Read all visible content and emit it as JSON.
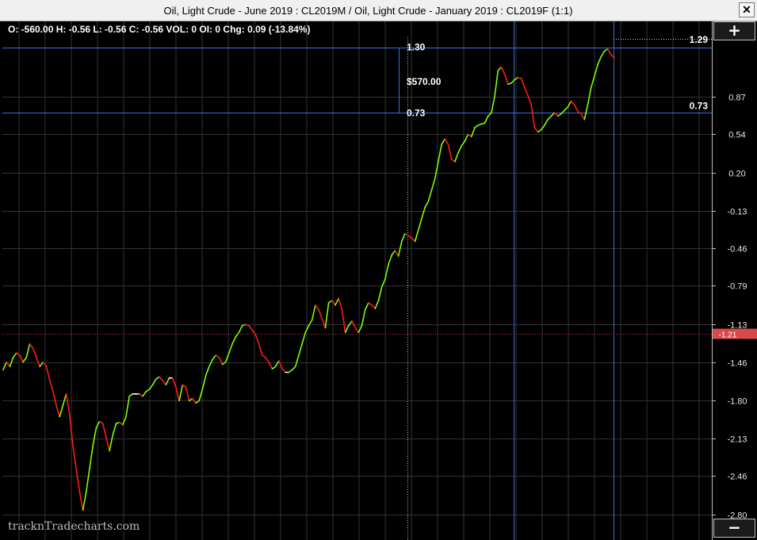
{
  "window": {
    "title": "Oil, Light Crude - June 2019 : CL2019M / Oil, Light Crude - January 2019 : CL2019F  (1:1)",
    "close_label": "✕"
  },
  "stats": {
    "text": "O: -560.00  H: -0.56  L: -0.56  C: -0.56 VOL: 0 OI: 0 Chg: 0.09 (-13.84%)"
  },
  "controls": {
    "zoom_in_label": "+",
    "zoom_out_label": "−"
  },
  "watermark": "tracknTradecharts.com",
  "colors": {
    "background": "#000000",
    "up": "#7fff00",
    "down": "#ff1a1a",
    "flat": "#ffffff",
    "grid": "#333333",
    "measure": "#3b6fe0",
    "last_badge": "#d84a4a"
  },
  "chart_data": {
    "type": "line",
    "ylim": [
      -2.9,
      1.35
    ],
    "yticks": [
      -2.8,
      -2.46,
      -2.13,
      -1.8,
      -1.46,
      -1.13,
      -0.79,
      -0.46,
      -0.13,
      0.2,
      0.54,
      0.87
    ],
    "ytick_labels": [
      "-2.80",
      "-2.46",
      "-2.13",
      "-1.80",
      "-1.46",
      "-1.13",
      "-0.79",
      "-0.46",
      "-0.13",
      "0.20",
      "0.54",
      "0.87"
    ],
    "last_value": -1.21,
    "last_label": "-1.21",
    "grid": true,
    "x": [
      0,
      1,
      2,
      3,
      4,
      5,
      6,
      7,
      8,
      9,
      10,
      11,
      12,
      13,
      14,
      15,
      16,
      17,
      18,
      19,
      20,
      21,
      22,
      23,
      24,
      25,
      26,
      27,
      28,
      29,
      30,
      31,
      32,
      33,
      34,
      35,
      36,
      37,
      38,
      39,
      40,
      41,
      42,
      43,
      44,
      45,
      46,
      47,
      48,
      49,
      50,
      51,
      52,
      53,
      54,
      55,
      56,
      57,
      58,
      59,
      60,
      61,
      62,
      63,
      64,
      65,
      66,
      67,
      68,
      69,
      70,
      71,
      72,
      73,
      74,
      75,
      76,
      77,
      78,
      79,
      80,
      81,
      82,
      83,
      84,
      85,
      86,
      87,
      88,
      89,
      90,
      91,
      92,
      93,
      94,
      95,
      96,
      97,
      98,
      99,
      100,
      101,
      102,
      103,
      104,
      105,
      106,
      107,
      108,
      109,
      110,
      111,
      112,
      113,
      114,
      115,
      116,
      117,
      118,
      119,
      120,
      121,
      122,
      123,
      124,
      125,
      126,
      127,
      128,
      129,
      130,
      131,
      132,
      133,
      134,
      135,
      136,
      137,
      138,
      139,
      140,
      141,
      142,
      143,
      144,
      145,
      146,
      147,
      148,
      149,
      150,
      151,
      152,
      153,
      154,
      155,
      156,
      157,
      158,
      159,
      160,
      161,
      162,
      163,
      164,
      165,
      166,
      167,
      168,
      169,
      170,
      171,
      172,
      173,
      174,
      175,
      176,
      177,
      178,
      179,
      180,
      181,
      182,
      183,
      184,
      185,
      186,
      187,
      188,
      189,
      190,
      191,
      192,
      193,
      194,
      195,
      196,
      197,
      198
    ],
    "values": [
      -1.53,
      -1.46,
      -1.5,
      -1.42,
      -1.38,
      -1.4,
      -1.46,
      -1.42,
      -1.3,
      -1.34,
      -1.42,
      -1.5,
      -1.46,
      -1.5,
      -1.62,
      -1.72,
      -1.84,
      -1.94,
      -1.84,
      -1.74,
      -1.92,
      -2.2,
      -2.4,
      -2.6,
      -2.76,
      -2.6,
      -2.4,
      -2.2,
      -2.04,
      -1.98,
      -2.0,
      -2.12,
      -2.24,
      -2.1,
      -2.0,
      -1.99,
      -2.01,
      -1.94,
      -1.76,
      -1.74,
      -1.74,
      -1.74,
      -1.76,
      -1.72,
      -1.7,
      -1.66,
      -1.61,
      -1.59,
      -1.62,
      -1.66,
      -1.6,
      -1.6,
      -1.68,
      -1.8,
      -1.66,
      -1.68,
      -1.8,
      -1.78,
      -1.82,
      -1.8,
      -1.7,
      -1.58,
      -1.5,
      -1.44,
      -1.4,
      -1.42,
      -1.48,
      -1.46,
      -1.38,
      -1.3,
      -1.24,
      -1.2,
      -1.14,
      -1.13,
      -1.14,
      -1.18,
      -1.22,
      -1.3,
      -1.4,
      -1.42,
      -1.46,
      -1.52,
      -1.5,
      -1.45,
      -1.52,
      -1.55,
      -1.55,
      -1.53,
      -1.5,
      -1.4,
      -1.3,
      -1.2,
      -1.14,
      -1.09,
      -0.96,
      -1.0,
      -1.08,
      -1.16,
      -0.94,
      -0.92,
      -0.96,
      -0.9,
      -1.0,
      -1.2,
      -1.14,
      -1.1,
      -1.16,
      -1.2,
      -1.14,
      -1.0,
      -0.94,
      -0.96,
      -0.99,
      -0.92,
      -0.8,
      -0.73,
      -0.6,
      -0.52,
      -0.48,
      -0.53,
      -0.4,
      -0.33,
      -0.35,
      -0.37,
      -0.4,
      -0.3,
      -0.2,
      -0.1,
      -0.05,
      0.05,
      0.15,
      0.3,
      0.45,
      0.5,
      0.45,
      0.32,
      0.3,
      0.38,
      0.44,
      0.48,
      0.54,
      0.52,
      0.6,
      0.62,
      0.63,
      0.64,
      0.7,
      0.73,
      0.88,
      1.1,
      1.13,
      1.07,
      0.98,
      0.99,
      1.02,
      1.04,
      1.03,
      0.95,
      0.88,
      0.8,
      0.6,
      0.56,
      0.58,
      0.62,
      0.67,
      0.7,
      0.73,
      0.7,
      0.72,
      0.75,
      0.78,
      0.83,
      0.8,
      0.74,
      0.72,
      0.67,
      0.8,
      0.95,
      1.05,
      1.15,
      1.22,
      1.27,
      1.29,
      1.24,
      1.21
    ],
    "measurement": {
      "start_x": 118,
      "end_x": 186,
      "start_value": 0.73,
      "end_value": 1.3,
      "start_label": "0.73",
      "end_label": "1.30",
      "amount_label": "$570.00",
      "right_high_label": "1.29",
      "right_low_label": "0.73"
    }
  }
}
